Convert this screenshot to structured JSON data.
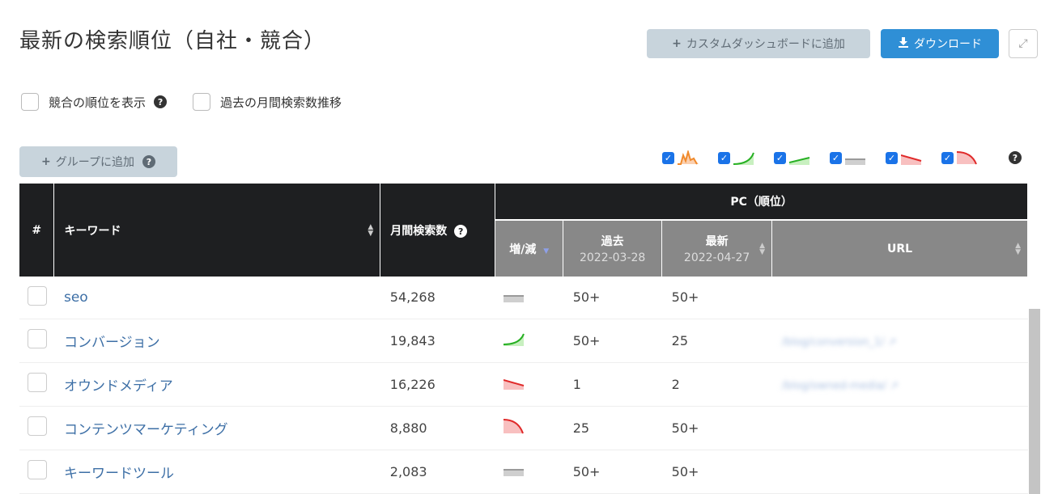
{
  "header": {
    "title": "最新の検索順位（自社・競合）",
    "custom_dashboard_label": "カスタムダッシュボードに追加",
    "download_label": "ダウンロード"
  },
  "options": {
    "show_competitor_label": "競合の順位を表示",
    "monthly_trend_label": "過去の月間検索数推移"
  },
  "toolbar": {
    "add_group_label": "グループに追加"
  },
  "legend": [
    {
      "icon": "spike-trend-icon",
      "checked": true
    },
    {
      "icon": "rising-trend-icon",
      "checked": true
    },
    {
      "icon": "slight-rise-icon",
      "checked": true
    },
    {
      "icon": "flat-trend-icon",
      "checked": true
    },
    {
      "icon": "slight-fall-icon",
      "checked": true
    },
    {
      "icon": "falling-trend-icon",
      "checked": true
    }
  ],
  "table": {
    "col_num": "#",
    "col_keyword": "キーワード",
    "col_volume": "月間検索数",
    "group_pc": "PC（順位）",
    "col_change": "増/減",
    "col_past": "過去",
    "col_past_date": "2022-03-28",
    "col_latest": "最新",
    "col_latest_date": "2022-04-27",
    "col_url": "URL",
    "rows": [
      {
        "keyword": "seo",
        "volume": "54,268",
        "trend": "flat",
        "past": "50+",
        "latest": "50+",
        "url": ""
      },
      {
        "keyword": "コンバージョン",
        "volume": "19,843",
        "trend": "rise",
        "past": "50+",
        "latest": "25",
        "url": "/blog/conversion_1/"
      },
      {
        "keyword": "オウンドメディア",
        "volume": "16,226",
        "trend": "slight-fall",
        "past": "1",
        "latest": "2",
        "url": "/blog/owned-media/"
      },
      {
        "keyword": "コンテンツマーケティング",
        "volume": "8,880",
        "trend": "fall",
        "past": "25",
        "latest": "50+",
        "url": ""
      },
      {
        "keyword": "キーワードツール",
        "volume": "2,083",
        "trend": "flat",
        "past": "50+",
        "latest": "50+",
        "url": ""
      }
    ]
  },
  "colors": {
    "accent": "#2f8fd6",
    "header_dark": "#1e1f21",
    "header_grey": "#888888",
    "link": "#3d6fa6"
  }
}
